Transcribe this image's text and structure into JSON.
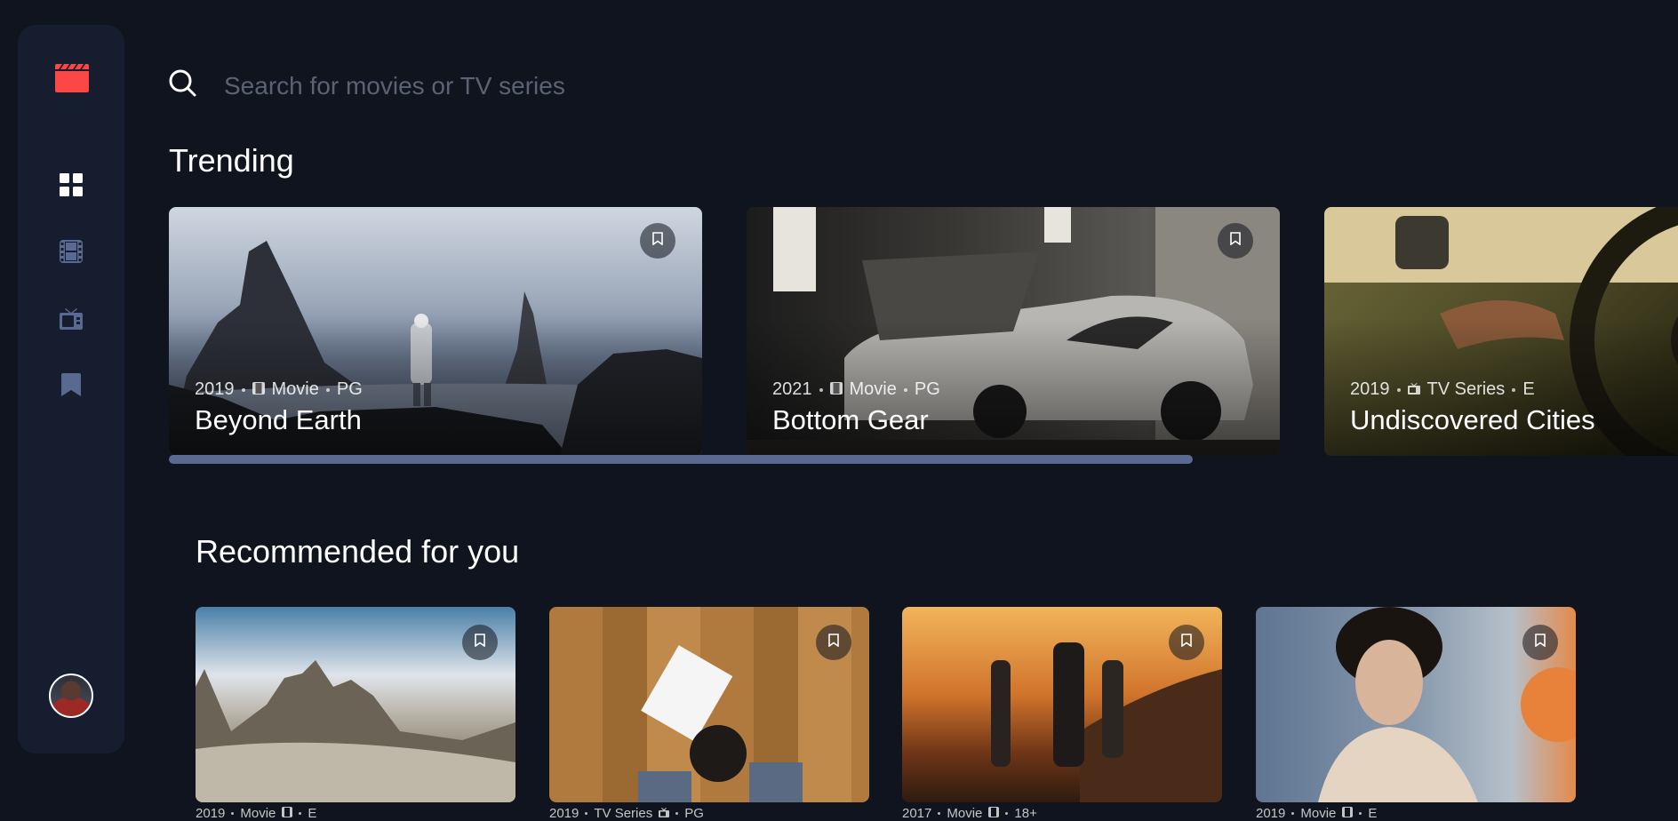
{
  "app": {
    "brand_color": "#fc4747",
    "icon": "clapperboard-icon"
  },
  "nav": {
    "items": [
      {
        "name": "home",
        "icon": "grid-icon",
        "active": true
      },
      {
        "name": "movies",
        "icon": "film-icon",
        "active": false
      },
      {
        "name": "tv-series",
        "icon": "tv-icon",
        "active": false
      },
      {
        "name": "bookmarks",
        "icon": "bookmark-icon",
        "active": false
      }
    ]
  },
  "search": {
    "placeholder": "Search for movies or TV series"
  },
  "trending": {
    "heading": "Trending",
    "items": [
      {
        "year": "2019",
        "category": "Movie",
        "rating": "PG",
        "title": "Beyond Earth"
      },
      {
        "year": "2021",
        "category": "Movie",
        "rating": "PG",
        "title": "Bottom Gear"
      },
      {
        "year": "2019",
        "category": "TV Series",
        "rating": "E",
        "title": "Undiscovered Cities"
      }
    ]
  },
  "recommended": {
    "heading": "Recommended for you",
    "items": [
      {
        "year": "2019",
        "category": "Movie",
        "rating": "E"
      },
      {
        "year": "2019",
        "category": "TV Series",
        "rating": "PG"
      },
      {
        "year": "2017",
        "category": "Movie",
        "rating": "18+"
      },
      {
        "year": "2019",
        "category": "Movie",
        "rating": "E"
      }
    ]
  },
  "colors": {
    "background": "#10141e",
    "surface": "#161d2f",
    "muted": "#5a698f"
  }
}
